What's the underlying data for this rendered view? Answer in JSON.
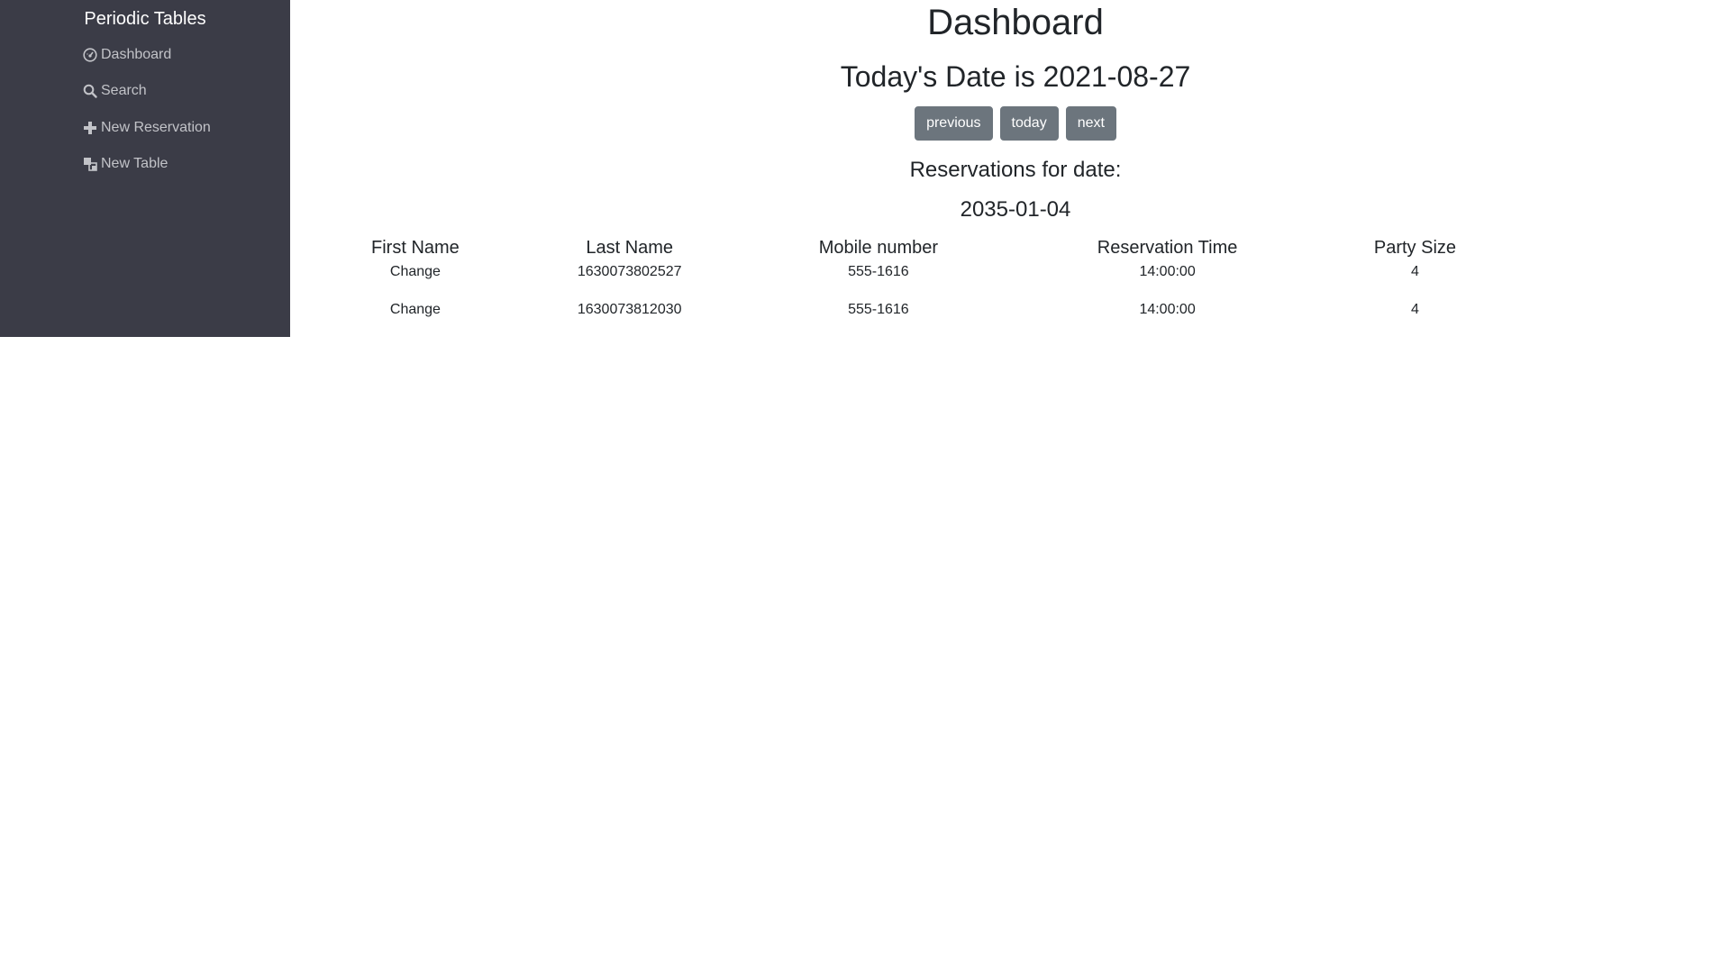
{
  "sidebar": {
    "brand": "Periodic Tables",
    "items": [
      {
        "label": "Dashboard",
        "icon": "dashboard-icon"
      },
      {
        "label": "Search",
        "icon": "search-icon"
      },
      {
        "label": "New Reservation",
        "icon": "plus-icon"
      },
      {
        "label": "New Table",
        "icon": "table-icon"
      }
    ]
  },
  "main": {
    "title": "Dashboard",
    "today_heading": "Today's Date is 2021-08-27",
    "buttons": {
      "previous": "previous",
      "today": "today",
      "next": "next"
    },
    "reservations_heading": "Reservations for date:",
    "reservations_date": "2035-01-04",
    "table": {
      "headers": [
        "First Name",
        "Last Name",
        "Mobile number",
        "Reservation Time",
        "Party Size"
      ],
      "rows": [
        [
          "Change",
          "1630073802527",
          "555-1616",
          "14:00:00",
          "4"
        ],
        [
          "Change",
          "1630073812030",
          "555-1616",
          "14:00:00",
          "4"
        ]
      ]
    }
  },
  "colors": {
    "sidebar_bg": "#3b3c47",
    "sidebar_text": "#c2c3c8",
    "button_bg": "#6c757d",
    "text": "#212529"
  }
}
